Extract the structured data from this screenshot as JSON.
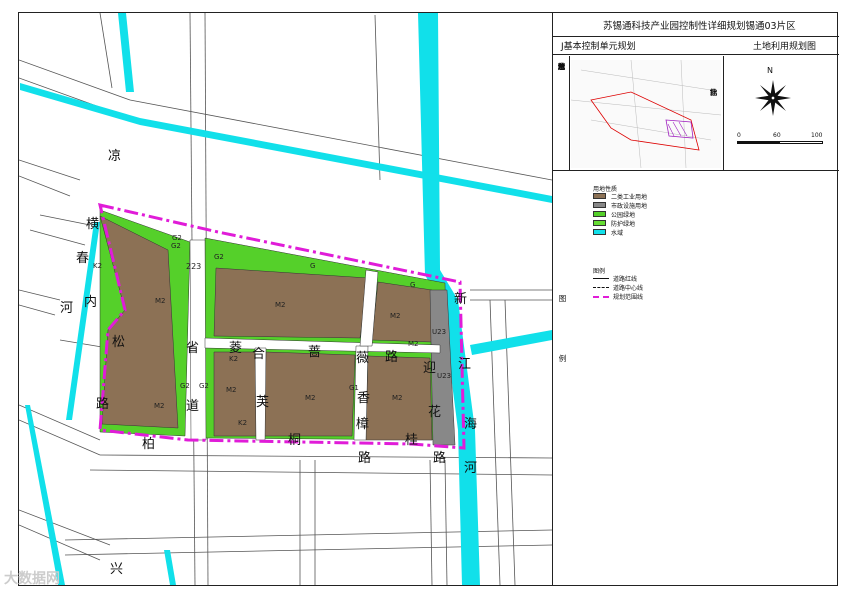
{
  "title": {
    "main": "苏锡通科技产业园控制性详细规划锡通03片区",
    "sub_left": "J基本控制单元规划",
    "sub_right": "土地利用规划图"
  },
  "location_label": [
    "单",
    "元",
    "位",
    "置",
    "示",
    "意",
    "图"
  ],
  "compass_label": [
    "指",
    "北",
    "针"
  ],
  "north_letter": "N",
  "scale_ticks": [
    "0",
    "60",
    "100"
  ],
  "legend": {
    "title": "用地性质",
    "items": [
      {
        "code": "M2",
        "label": "二类工业用地",
        "color": "#8c7155"
      },
      {
        "code": "U",
        "label": "市政设施用地",
        "color": "#888888"
      },
      {
        "code": "G1",
        "label": "公园绿地",
        "color": "#55d02a"
      },
      {
        "code": "G2",
        "label": "防护绿地",
        "color": "#66dd33"
      },
      {
        "code": "E1",
        "label": "水域",
        "color": "#11e0ea"
      }
    ],
    "line_title": "图例",
    "lines": [
      {
        "label": "道路红线",
        "style": "solid"
      },
      {
        "label": "道路中心线",
        "style": "dash"
      },
      {
        "label": "规划范围线",
        "style": "dashdot"
      }
    ]
  },
  "side_marks": [
    "图",
    "例"
  ],
  "road_names": {
    "liangxian": "凉",
    "pinghe": "横",
    "chunhe": "春",
    "he_left": "河",
    "nei": "内",
    "song": "松",
    "lu_left": "路",
    "bo": "柏",
    "sheng": "省",
    "dao": "道",
    "s223": "223",
    "ling": "菱",
    "he2": "合",
    "fu": "芙",
    "qiang": "蔷",
    "wei": "薇",
    "lu_center": "路",
    "xiang": "香",
    "zhang": "樟",
    "tong": "桐",
    "lu_bottom": "路",
    "ying": "迎",
    "hua": "花",
    "lu_bottom2": "路",
    "gui": "桂",
    "xin": "新",
    "jiang": "江",
    "hai": "海",
    "he_right": "河",
    "xing": "兴"
  },
  "land_codes": {
    "nw_k2": "K2",
    "nw_m2": "M2",
    "w_m2": "M2",
    "g2_a": "G2",
    "g2_b": "G2",
    "g2_c": "G2",
    "g2_d": "G2",
    "n_g2": "G",
    "ne_g2": "G",
    "c_m2": "M2",
    "e_m2": "M2",
    "e_m2b": "M2",
    "s_k2a": "K2",
    "s_k2b": "K2",
    "s_m2a": "M2",
    "s_m2b": "M2",
    "s_m2c": "M2",
    "s_g1": "G1",
    "u23": "U23",
    "u23b": "U23",
    "w_g2": "G2"
  },
  "watermark": "大数据网"
}
